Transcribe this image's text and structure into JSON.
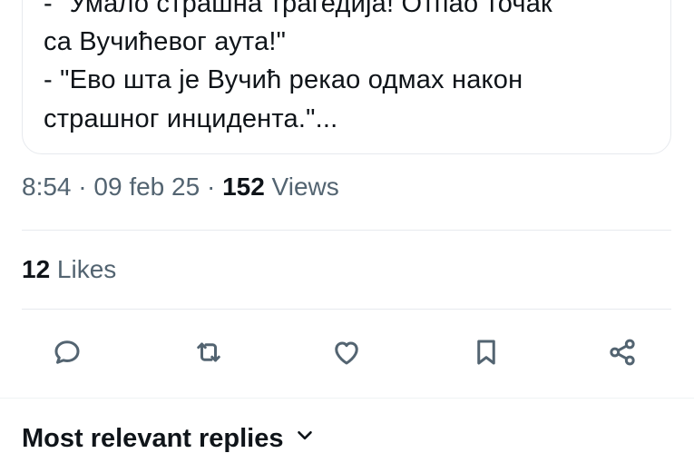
{
  "quote": {
    "lines": [
      "- \"Умало страшна трагедија! Отпао точак",
      "са Вучићевог аута!\"",
      "- \"Ево шта је Вучић рекао одмах након",
      "страшног инцидента.\"..."
    ]
  },
  "meta": {
    "time": "8:54",
    "sep1": " · ",
    "date": "09 feb 25",
    "sep2": " · ",
    "views_count": "152",
    "views_label": " Views"
  },
  "likes": {
    "count": "12",
    "label": " Likes"
  },
  "actions": {
    "icons": [
      "reply-icon",
      "repost-icon",
      "like-icon",
      "bookmark-icon",
      "share-icon"
    ]
  },
  "replies": {
    "title": "Most relevant replies",
    "icon": "chevron-down-icon"
  },
  "colors": {
    "text": "#0f1419",
    "secondary": "#536471",
    "border": "#e7eaee"
  }
}
